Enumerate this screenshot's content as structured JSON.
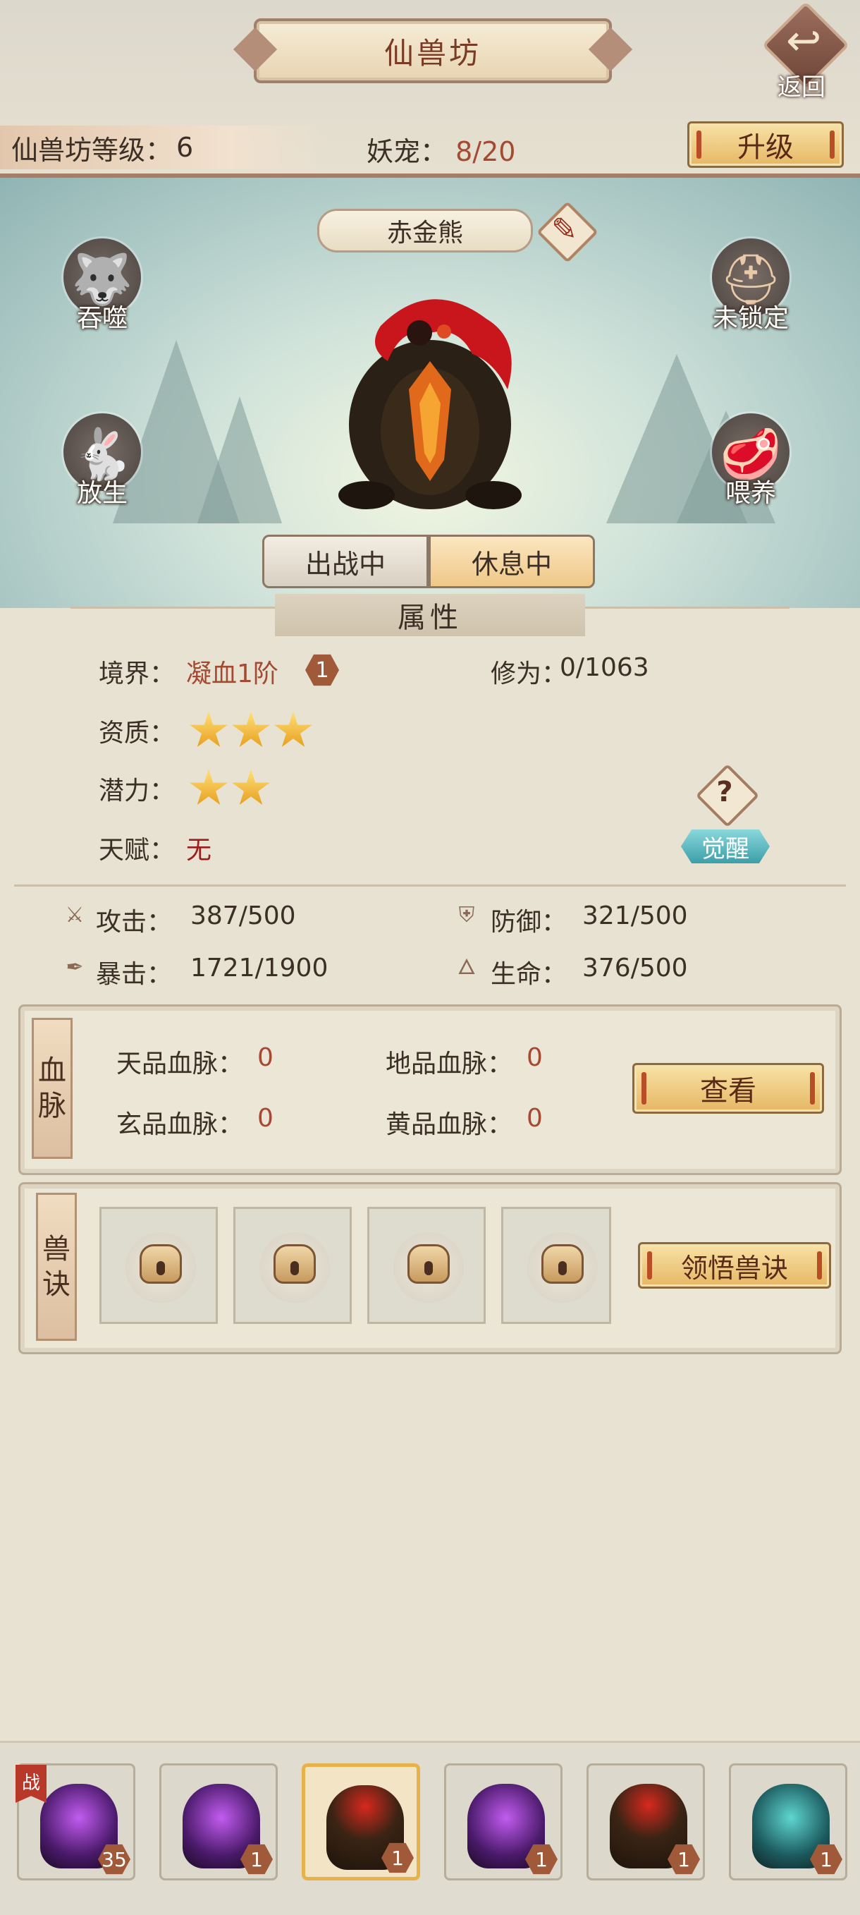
{
  "header": {
    "title": "仙兽坊",
    "back_label": "返回",
    "level_label": "仙兽坊等级：",
    "level_value": "6",
    "pets_label": "妖宠：",
    "pets_value": "8/20",
    "upgrade_label": "升级"
  },
  "pet": {
    "name": "赤金熊",
    "actions": {
      "devour": "吞噬",
      "release": "放生",
      "lock": "未锁定",
      "feed": "喂养"
    },
    "status": {
      "fight": "出战中",
      "rest": "休息中",
      "active": "rest"
    }
  },
  "attributes": {
    "header": "属性",
    "realm_label": "境界：",
    "realm_value": "凝血1阶",
    "realm_badge": "1",
    "cultivation_label": "修为：",
    "cultivation_value": "0/1063",
    "aptitude_label": "资质：",
    "aptitude_stars": 3,
    "potential_label": "潜力：",
    "potential_stars": 2,
    "talent_label": "天赋：",
    "talent_value": "无",
    "awaken_icon": "?",
    "awaken_label": "觉醒"
  },
  "stats": {
    "attack_label": "攻击：",
    "attack_value": "387/500",
    "defense_label": "防御：",
    "defense_value": "321/500",
    "crit_label": "暴击：",
    "crit_value": "1721/1900",
    "hp_label": "生命：",
    "hp_value": "376/500"
  },
  "bloodline": {
    "tag_top": "血",
    "tag_bottom": "脉",
    "heaven_label": "天品血脉：",
    "heaven_value": "0",
    "earth_label": "地品血脉：",
    "earth_value": "0",
    "mystic_label": "玄品血脉：",
    "mystic_value": "0",
    "yellow_label": "黄品血脉：",
    "yellow_value": "0",
    "view_label": "查看"
  },
  "skills": {
    "tag_top": "兽",
    "tag_bottom": "诀",
    "learn_label": "领悟兽诀"
  },
  "roster": {
    "battle_flag": "战",
    "pets": [
      {
        "level": "35",
        "kind": "purple"
      },
      {
        "level": "1",
        "kind": "purple"
      },
      {
        "level": "1",
        "kind": "red",
        "selected": true
      },
      {
        "level": "1",
        "kind": "purple"
      },
      {
        "level": "1",
        "kind": "red"
      },
      {
        "level": "1",
        "kind": "teal"
      }
    ]
  },
  "colors": {
    "accent_red": "#a44a32",
    "gold_button": "#e6b764",
    "awaken_teal": "#3c9fa8",
    "star": "#f4b82a"
  }
}
